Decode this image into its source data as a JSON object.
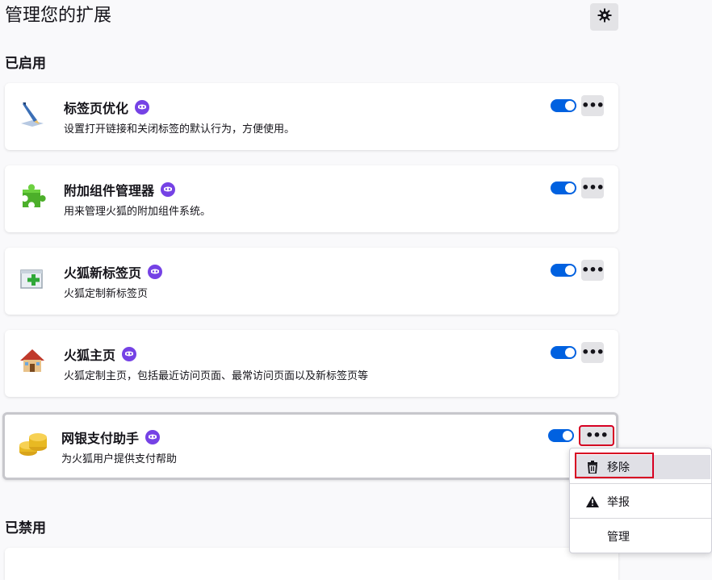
{
  "header": {
    "title": "管理您的扩展",
    "settings_icon": "gear-icon"
  },
  "sections": {
    "enabled_title": "已启用",
    "disabled_title": "已禁用"
  },
  "extensions": [
    {
      "name": "标签页优化",
      "description": "设置打开链接和关闭标签的默认行为，方便使用。",
      "icon": "tab-optimize-icon",
      "enabled": true
    },
    {
      "name": "附加组件管理器",
      "description": "用来管理火狐的附加组件系统。",
      "icon": "puzzle-icon",
      "enabled": true
    },
    {
      "name": "火狐新标签页",
      "description": "火狐定制新标签页",
      "icon": "new-tab-icon",
      "enabled": true
    },
    {
      "name": "火狐主页",
      "description": "火狐定制主页，包括最近访问页面、最常访问页面以及新标签页等",
      "icon": "home-icon",
      "enabled": true
    },
    {
      "name": "网银支付助手",
      "description": "为火狐用户提供支付帮助",
      "icon": "coins-icon",
      "enabled": true
    }
  ],
  "context_menu": {
    "items": [
      {
        "label": "移除",
        "icon": "trash-icon"
      },
      {
        "label": "举报",
        "icon": "warning-icon"
      },
      {
        "label": "管理",
        "icon": ""
      }
    ]
  },
  "colors": {
    "toggle_on": "#0061e0",
    "badge": "#7542e5",
    "highlight": "#d70022"
  }
}
